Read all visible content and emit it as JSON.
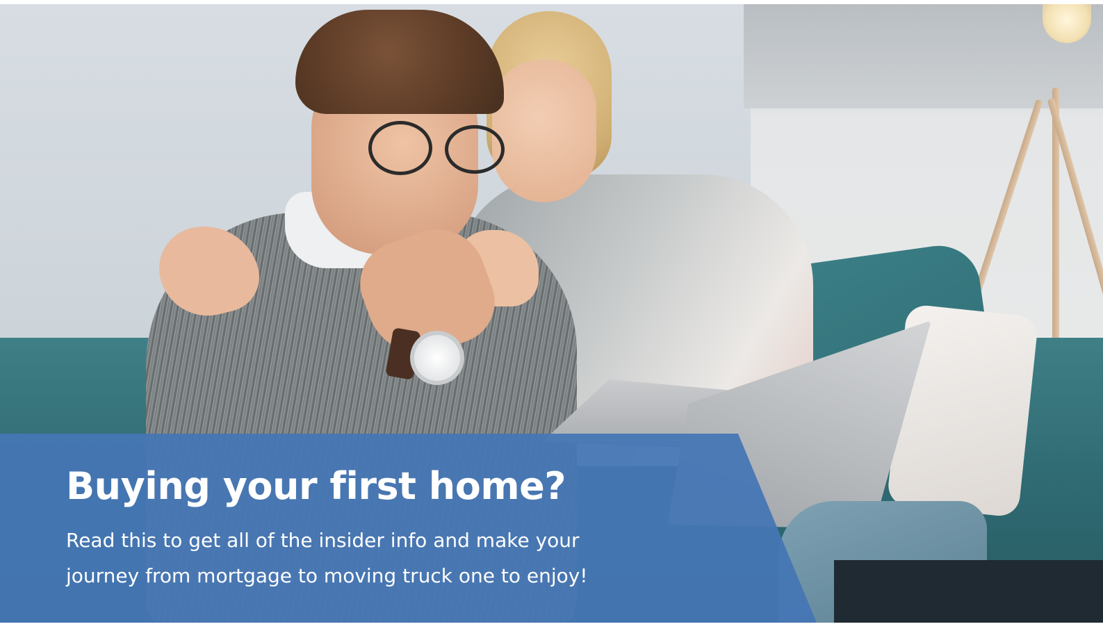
{
  "hero": {
    "image_description_icon": "photo-couple-laptop-icon",
    "headline": "Buying your first home?",
    "subtext": "Read this to get all of the insider info and make your journey from mortgage to moving truck one to enjoy!"
  },
  "colors": {
    "overlay_panel": "#4576B5",
    "text": "#FFFFFF"
  }
}
